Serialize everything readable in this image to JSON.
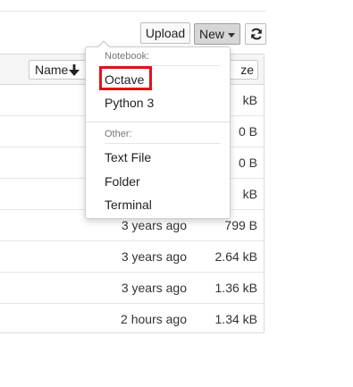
{
  "toolbar": {
    "upload_label": "Upload",
    "new_label": "New",
    "refresh_icon": "refresh-icon"
  },
  "list": {
    "header": {
      "name_sort_label": "Name",
      "name_sort_icon": "arrow-down-icon",
      "size_sort_label": "ze"
    },
    "rows": [
      {
        "modified": "",
        "size": "kB"
      },
      {
        "modified": "",
        "size": "0 B"
      },
      {
        "modified": "",
        "size": "0 B"
      },
      {
        "modified": "",
        "size": "kB"
      },
      {
        "modified": "3 years ago",
        "size": "799 B"
      },
      {
        "modified": "3 years ago",
        "size": "2.64 kB"
      },
      {
        "modified": "3 years ago",
        "size": "1.36 kB"
      },
      {
        "modified": "2 hours ago",
        "size": "1.34 kB"
      }
    ]
  },
  "new_menu": {
    "notebook_header": "Notebook:",
    "notebook_items": [
      "Octave",
      "Python 3"
    ],
    "other_header": "Other:",
    "other_items": [
      "Text File",
      "Folder",
      "Terminal"
    ]
  },
  "highlight": {
    "target": "Octave",
    "color": "#e0131a"
  },
  "colors": {
    "accent_new_button": "#d6d6d6",
    "highlight_border": "#e0131a"
  }
}
